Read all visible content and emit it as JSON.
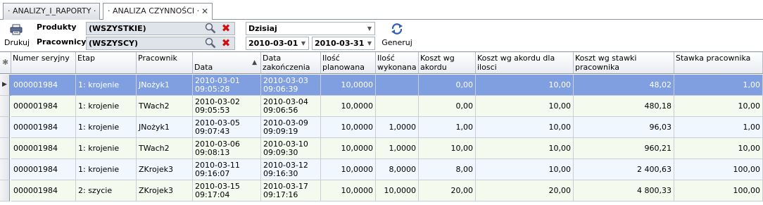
{
  "tabs": [
    {
      "label": "· ANALIZY_I_RAPORTY ·"
    },
    {
      "label": "· ANALIZA CZYNNOŚCI ·",
      "close": "✕"
    }
  ],
  "toolbar": {
    "print_label": "Drukuj",
    "products_label": "Produkty",
    "products_value": "(WSZYSTKIE)",
    "workers_label": "Pracownicy",
    "workers_value": "(WSZYSCY)",
    "period_value": "Dzisiaj",
    "date_from": "2010-03-01",
    "date_to": "2010-03-31",
    "generate_label": "Generuj"
  },
  "grid": {
    "columns": [
      "Numer seryjny",
      "Etap",
      "Pracownik",
      "Data\nrozpoczęcia",
      "Data\nzakończenia",
      "Ilość\nplanowana",
      "Ilość\nwykonana",
      "Koszt wg\nakordu",
      "Koszt wg akordu dla ilosci\ndo wyprodukowania",
      "Koszt wg stawki pracownika\n( stawka x czas RCP )",
      "Stawka pracownika"
    ],
    "rows": [
      [
        "000001984",
        "1: krojenie",
        "JNożyk1",
        "2010-03-01\n09:05:28",
        "2010-03-03\n09:06:39",
        "10,0000",
        "",
        "0,00",
        "10,00",
        "48,02",
        "1,00"
      ],
      [
        "000001984",
        "1: krojenie",
        "TWach2",
        "2010-03-02\n09:05:53",
        "2010-03-04\n09:06:56",
        "10,0000",
        "",
        "0,00",
        "10,00",
        "480,18",
        "10,00"
      ],
      [
        "000001984",
        "1: krojenie",
        "JNożyk1",
        "2010-03-05\n09:07:43",
        "2010-03-09\n09:09:19",
        "10,0000",
        "1,0000",
        "1,00",
        "10,00",
        "96,03",
        "1,00"
      ],
      [
        "000001984",
        "1: krojenie",
        "TWach2",
        "2010-03-06\n09:08:13",
        "2010-03-10\n09:09:30",
        "10,0000",
        "1,0000",
        "10,00",
        "10,00",
        "960,21",
        "10,00"
      ],
      [
        "000001984",
        "1: krojenie",
        "ZKrojek3",
        "2010-03-11\n09:16:07",
        "2010-03-12\n09:16:30",
        "10,0000",
        "8,0000",
        "8,00",
        "10,00",
        "2 400,63",
        "100,00"
      ],
      [
        "000001984",
        "2: szycie",
        "ZKrojek3",
        "2010-03-15\n09:17:04",
        "2010-03-17\n09:17:16",
        "10,0000",
        "10,0000",
        "20,00",
        "20,00",
        "4 800,33",
        "100,00"
      ]
    ],
    "sort_indicator": "▲",
    "row_pointer": "▶",
    "corner_mark": "✱"
  },
  "colors": {
    "selected_row": "#7f9fe0",
    "row_blue": "#f1f7ff",
    "row_green": "#f4faee",
    "delete_red": "#d01010"
  },
  "icons": [
    "printer-icon",
    "magnifier-icon",
    "delete-x-icon",
    "refresh-arrows-icon"
  ]
}
